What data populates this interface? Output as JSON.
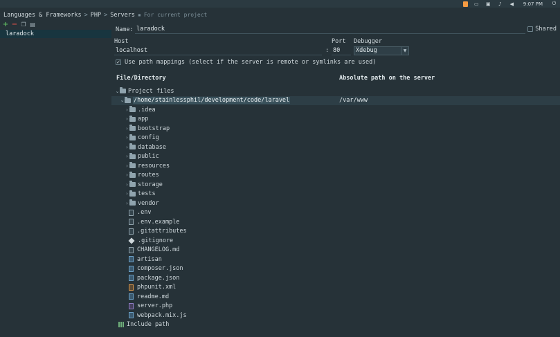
{
  "topbar": {
    "time": "9:07 PM"
  },
  "breadcrumb": {
    "items": [
      "Languages & Frameworks",
      "PHP",
      "Servers"
    ],
    "separator": ">",
    "hint": "For current project"
  },
  "sidebar": {
    "servers": [
      "laradock"
    ]
  },
  "form": {
    "name_label": "Name:",
    "name_value": "laradock",
    "shared_label": "Shared",
    "host_label": "Host",
    "port_label": "Port",
    "debugger_label": "Debugger",
    "host_value": "localhost",
    "port_value": "80",
    "debugger_value": "Xdebug",
    "path_mapping_label": "Use path mappings (select if the server is remote or symlinks are used)"
  },
  "mapping": {
    "col_file": "File/Directory",
    "col_server": "Absolute path on the server",
    "project_files": "Project files",
    "root_path": "/home/stainlessphil/development/code/laravel",
    "root_server_path": "/var/www",
    "folders": [
      ".idea",
      "app",
      "bootstrap",
      "config",
      "database",
      "public",
      "resources",
      "routes",
      "storage",
      "tests",
      "vendor"
    ],
    "files": [
      {
        "name": ".env",
        "icon": "text-file-icon",
        "kind": "plain"
      },
      {
        "name": ".env.example",
        "icon": "text-file-icon",
        "kind": "plain"
      },
      {
        "name": ".gitattributes",
        "icon": "text-file-icon",
        "kind": "plain"
      },
      {
        "name": ".gitignore",
        "icon": "git-icon",
        "kind": "git"
      },
      {
        "name": "CHANGELOG.md",
        "icon": "markdown-file-icon",
        "kind": "plain"
      },
      {
        "name": "artisan",
        "icon": "script-file-icon",
        "kind": "blue"
      },
      {
        "name": "composer.json",
        "icon": "json-file-icon",
        "kind": "blue"
      },
      {
        "name": "package.json",
        "icon": "json-file-icon",
        "kind": "blue"
      },
      {
        "name": "phpunit.xml",
        "icon": "xml-file-icon",
        "kind": "orange"
      },
      {
        "name": "readme.md",
        "icon": "markdown-file-icon",
        "kind": "blue"
      },
      {
        "name": "server.php",
        "icon": "php-file-icon",
        "kind": "purple"
      },
      {
        "name": "webpack.mix.js",
        "icon": "js-file-icon",
        "kind": "blue"
      }
    ],
    "include_path": "Include path"
  }
}
